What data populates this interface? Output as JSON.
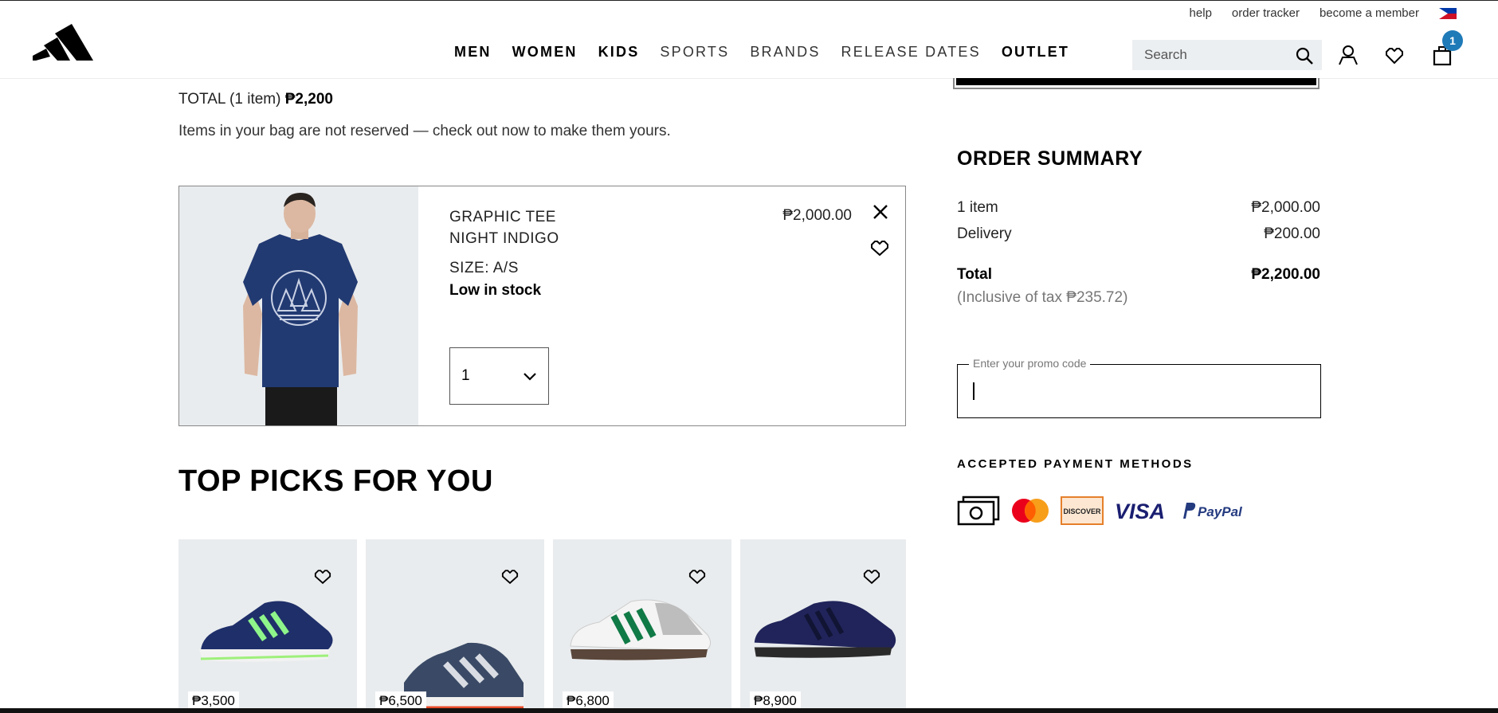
{
  "header": {
    "utility_links": [
      "help",
      "order tracker",
      "become a member"
    ],
    "nav": [
      {
        "label": "MEN",
        "style": "strong"
      },
      {
        "label": "WOMEN",
        "style": "strong"
      },
      {
        "label": "KIDS",
        "style": "strong"
      },
      {
        "label": "SPORTS",
        "style": "light"
      },
      {
        "label": "BRANDS",
        "style": "light"
      },
      {
        "label": "RELEASE DATES",
        "style": "light"
      },
      {
        "label": "OUTLET",
        "style": "strong"
      }
    ],
    "search_placeholder": "Search",
    "cart_count": "1"
  },
  "bag": {
    "total_prefix": "TOTAL (1 item)",
    "total_amount": "₱2,200",
    "notice": "Items in your bag are not reserved — check out now to make them yours.",
    "item": {
      "name_line1": "GRAPHIC TEE",
      "name_line2": "NIGHT INDIGO",
      "size": "SIZE: A/S",
      "stock": "Low in stock",
      "price": "₱2,000.00",
      "quantity": "1"
    }
  },
  "top_picks": {
    "title": "TOP PICKS FOR YOU",
    "items": [
      {
        "price": "₱3,500"
      },
      {
        "price": "₱6,500"
      },
      {
        "price": "₱6,800"
      },
      {
        "price": "₱8,900"
      }
    ]
  },
  "summary": {
    "title": "ORDER SUMMARY",
    "items_label": "1 item",
    "items_value": "₱2,000.00",
    "delivery_label": "Delivery",
    "delivery_value": "₱200.00",
    "total_label": "Total",
    "total_value": "₱2,200.00",
    "tax_note": "(Inclusive of tax  ₱235.72)",
    "promo_label": "Enter your promo code",
    "promo_value": "",
    "payment_title": "ACCEPTED PAYMENT METHODS",
    "payment_methods": [
      "cash-icon",
      "mastercard-icon",
      "discover-icon",
      "visa-icon",
      "paypal-icon"
    ],
    "discover_text": "DISCOVER",
    "visa_text": "VISA",
    "paypal_text": "PayPal"
  },
  "colors": {
    "accent_badge": "#1f7ab8",
    "product_bg": "#e9ecee"
  }
}
